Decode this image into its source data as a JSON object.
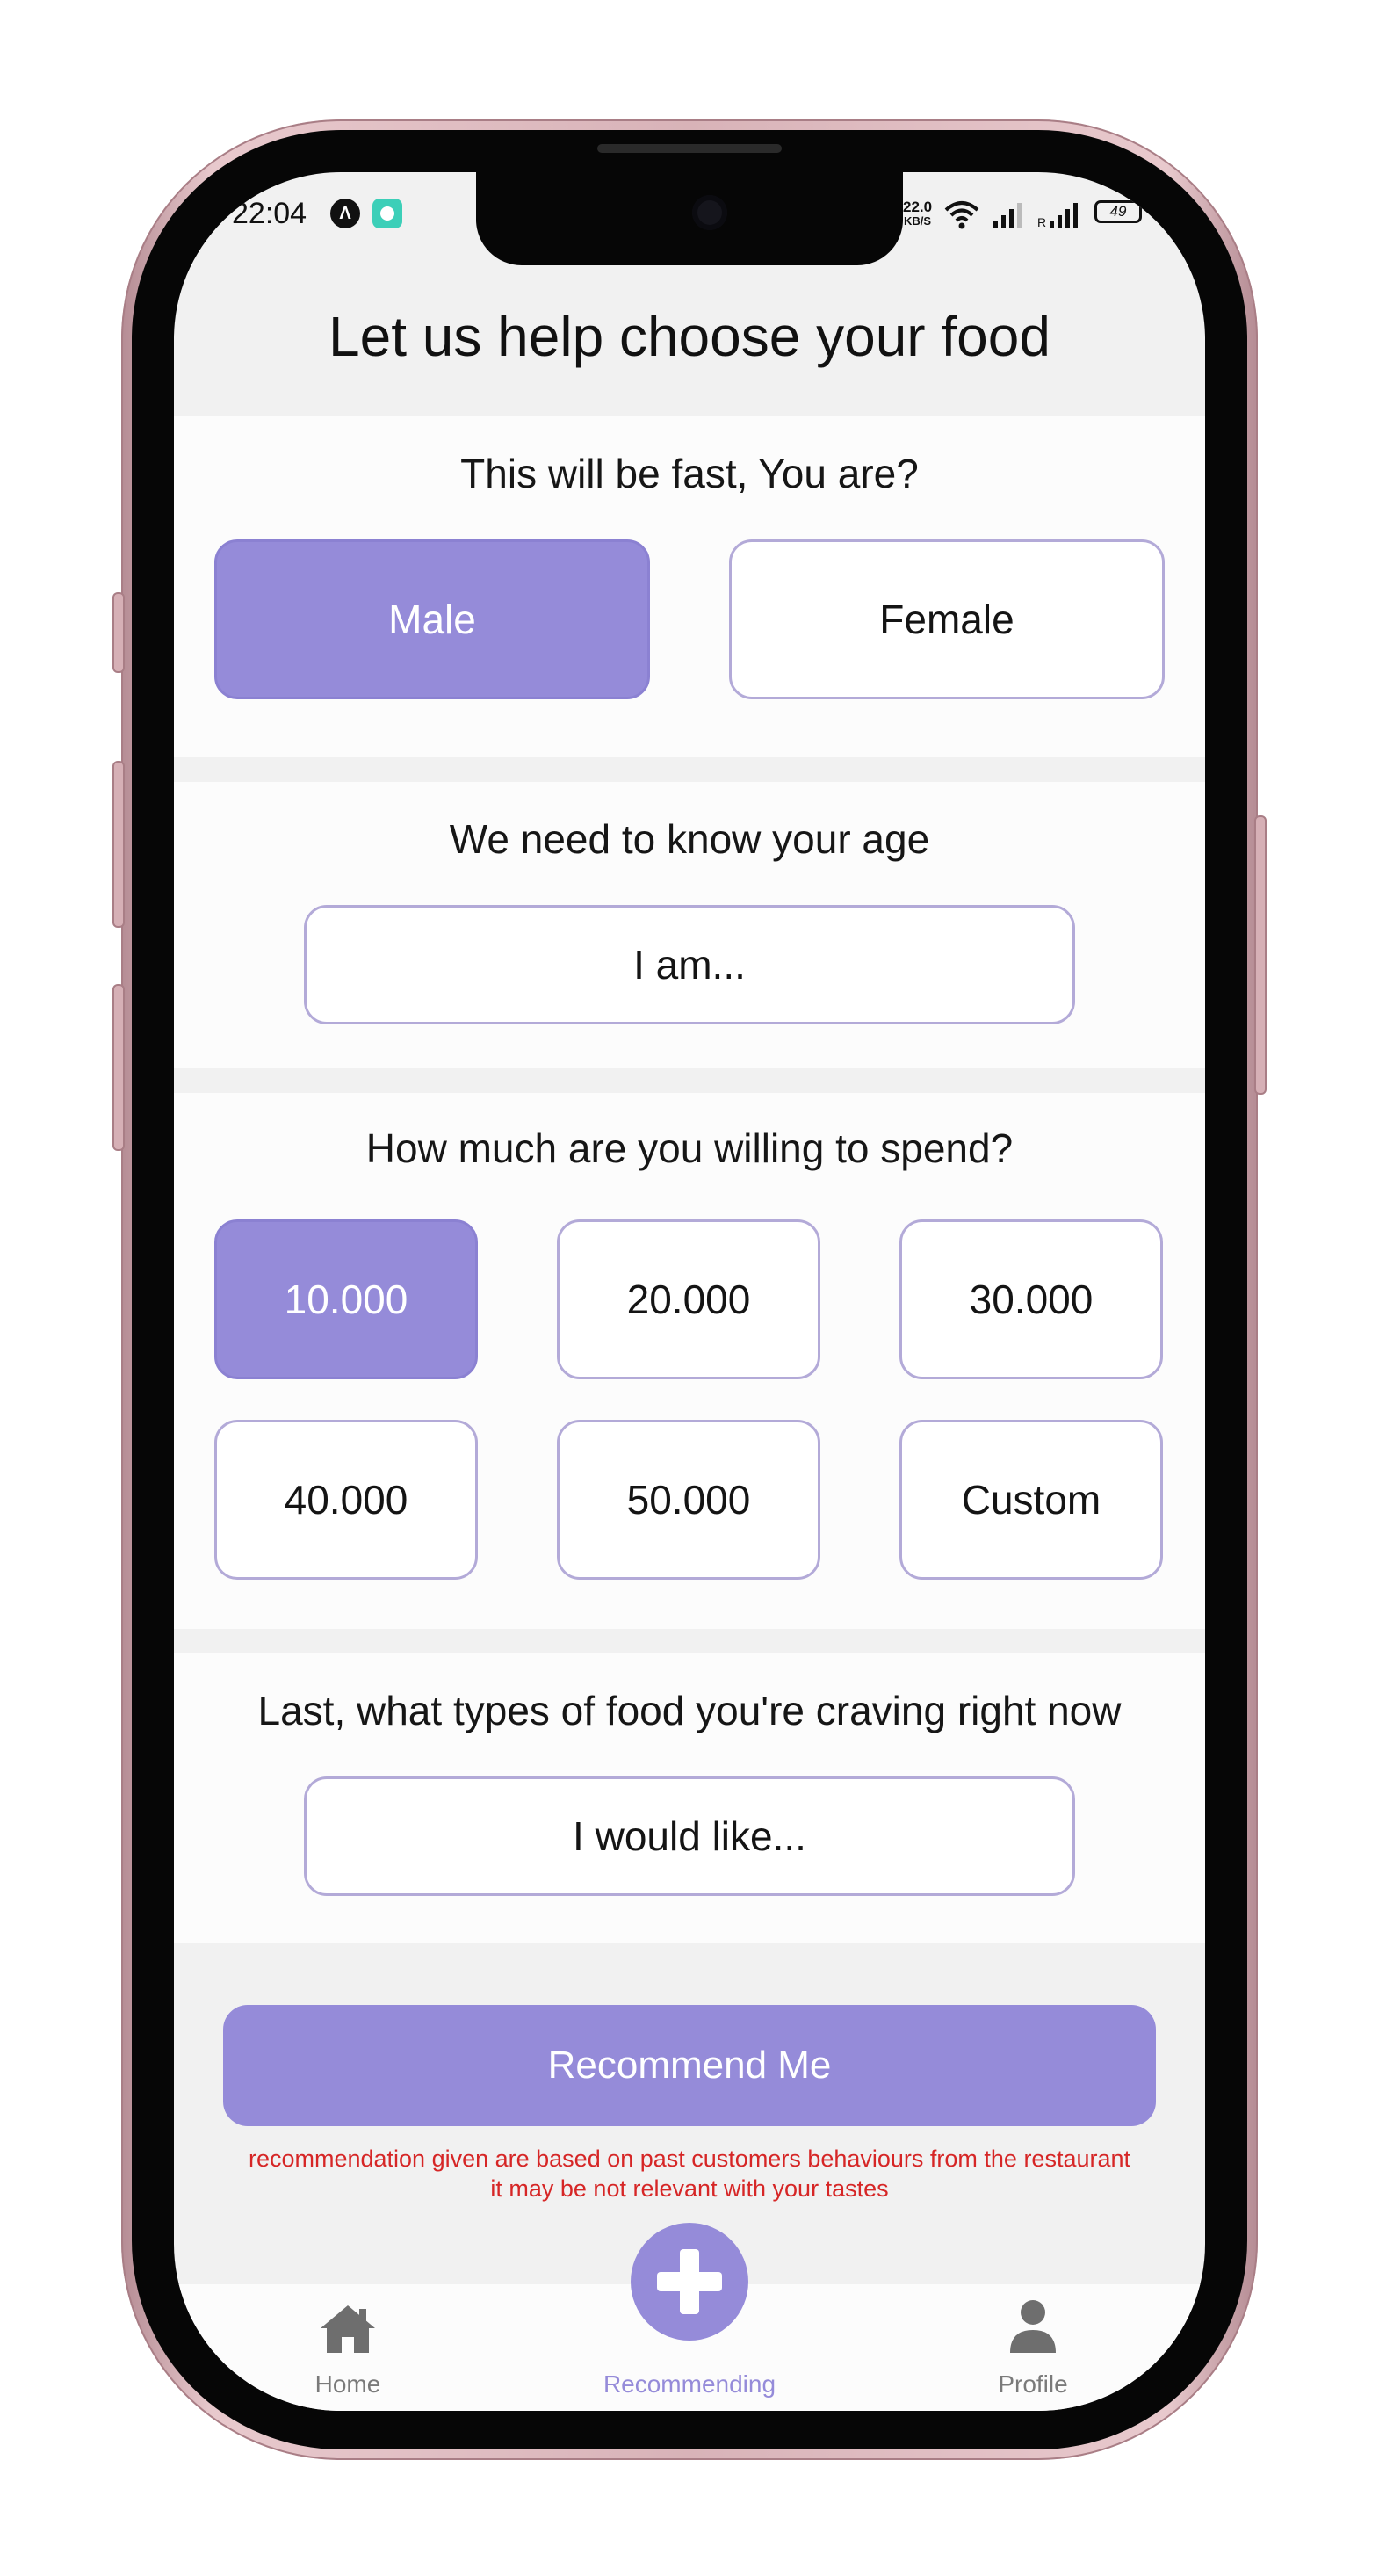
{
  "status_bar": {
    "time": "22:04",
    "app_badge": "Λ",
    "net_speed_value": "22.0",
    "net_speed_unit": "KB/S",
    "battery": "49"
  },
  "page": {
    "title": "Let us help choose your food"
  },
  "gender": {
    "question": "This will be fast, You are?",
    "options": [
      "Male",
      "Female"
    ],
    "selected": "Male"
  },
  "age": {
    "question": "We need to know your age",
    "placeholder": "I am..."
  },
  "budget": {
    "question": "How much are you willing to spend?",
    "options": [
      "10.000",
      "20.000",
      "30.000",
      "40.000",
      "50.000",
      "Custom"
    ],
    "selected": "10.000"
  },
  "food": {
    "question": "Last, what types of food you're craving right now",
    "placeholder": "I would like..."
  },
  "recommend": {
    "button_label": "Recommend Me",
    "disclaimer_line1": "recommendation given are based on past customers behaviours from the restaurant",
    "disclaimer_line2": "it may be not relevant with your tastes"
  },
  "bottom_nav": {
    "items": [
      {
        "label": "Home",
        "icon": "home-icon",
        "active": false
      },
      {
        "label": "Recommending",
        "icon": "plus-icon",
        "active": true
      },
      {
        "label": "Profile",
        "icon": "person-icon",
        "active": false
      }
    ]
  },
  "colors": {
    "accent": "#958bd9",
    "outline": "#b3aad8",
    "warning": "#d62626",
    "background": "#f1f1f1"
  }
}
